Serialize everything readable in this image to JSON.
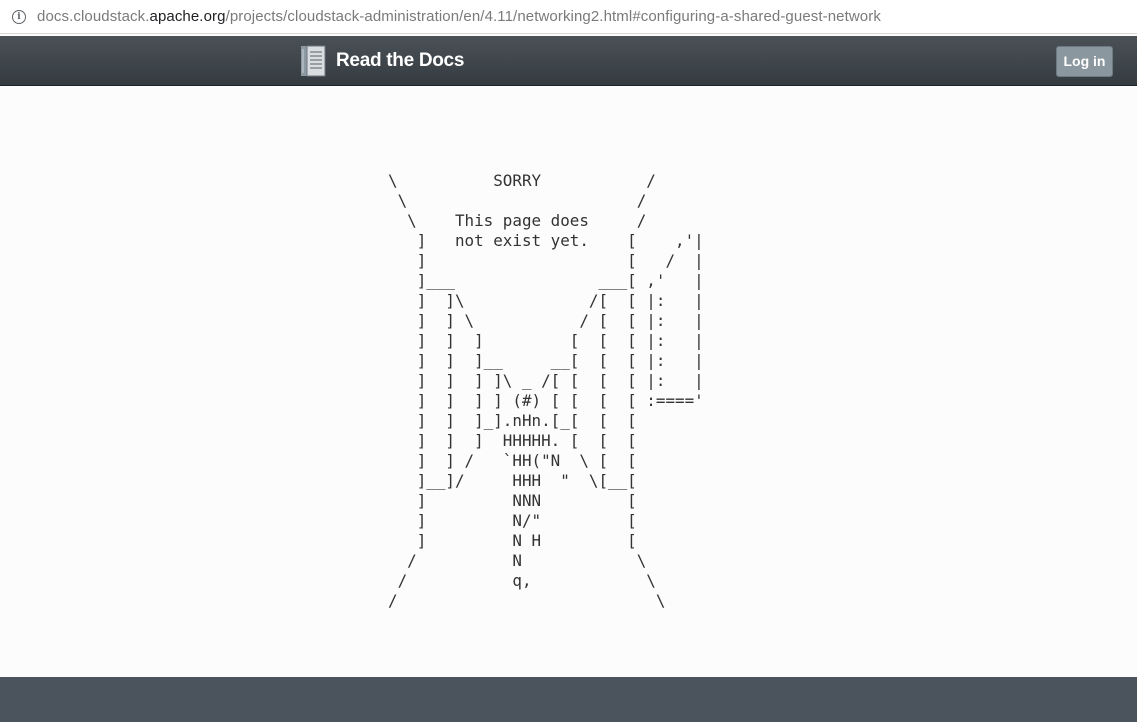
{
  "browser": {
    "url_prefix": "docs.cloudstack.",
    "url_domain": "apache.org",
    "url_path": "/projects/cloudstack-administration/en/4.11/networking2.html#configuring-a-shared-guest-network",
    "info_icon": "info-icon"
  },
  "navbar": {
    "brand_label": "Read the Docs",
    "brand_icon": "book-icon",
    "login_label": "Log in"
  },
  "main": {
    "art_lines": [
      "\\          SORRY           /",
      " \\                        /",
      "  \\    This page does     /",
      "   ]   not exist yet.    [    ,'|",
      "   ]                     [   /  |",
      "   ]___               ___[ ,'   |",
      "   ]  ]\\             /[  [ |:   |",
      "   ]  ] \\           / [  [ |:   |",
      "   ]  ]  ]         [  [  [ |:   |",
      "   ]  ]  ]__     __[  [  [ |:   |",
      "   ]  ]  ] ]\\ _ /[ [  [  [ |:   |",
      "   ]  ]  ] ] (#) [ [  [  [ :===='",
      "   ]  ]  ]_].nHn.[_[  [  [",
      "   ]  ]  ]  HHHHH. [  [  [",
      "   ]  ] /   `HH(\"N  \\ [  [",
      "   ]__]/     HHH  \"  \\[__[",
      "   ]         NNN         [",
      "   ]         N/\"         [",
      "   ]         N H         [",
      "  /          N            \\",
      " /           q,            \\",
      "/                           \\"
    ]
  },
  "colors": {
    "navbar": "#343b41",
    "login_button": "#8a979e",
    "footer": "#4b545c",
    "background": "#fcfcfc"
  }
}
